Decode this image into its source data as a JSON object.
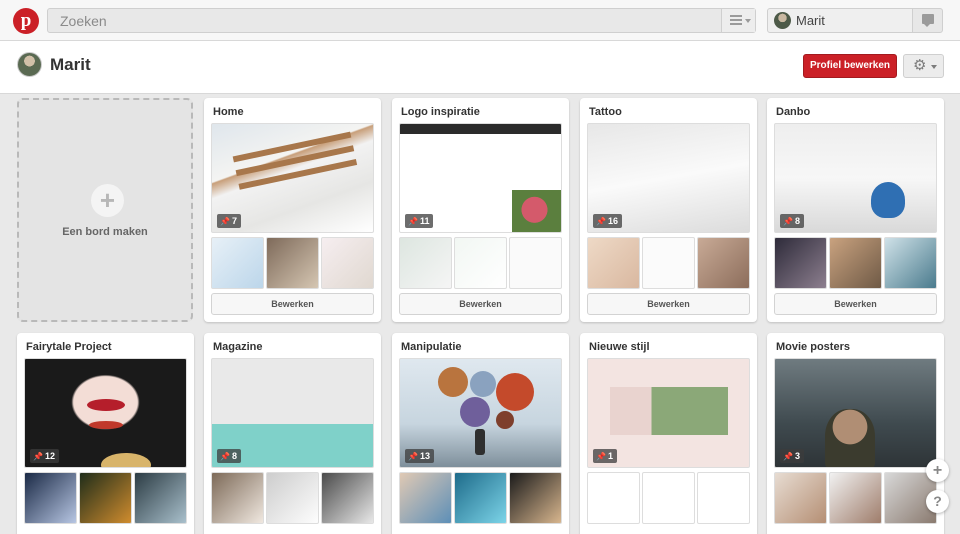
{
  "topbar": {
    "logo_letter": "p",
    "search_placeholder": "Zoeken",
    "user_name": "Marit"
  },
  "profile": {
    "name": "Marit",
    "edit_button": "Profiel bewerken"
  },
  "create_board": {
    "plus": "+",
    "label": "Een bord maken"
  },
  "boards": [
    {
      "title": "Home",
      "count": "7",
      "edit": "Bewerken"
    },
    {
      "title": "Logo inspiratie",
      "count": "11",
      "edit": "Bewerken"
    },
    {
      "title": "Tattoo",
      "count": "16",
      "edit": "Bewerken"
    },
    {
      "title": "Danbo",
      "count": "8",
      "edit": "Bewerken"
    },
    {
      "title": "Fairytale Project",
      "count": "12"
    },
    {
      "title": "Magazine",
      "count": "8"
    },
    {
      "title": "Manipulatie",
      "count": "13"
    },
    {
      "title": "Nieuwe stijl",
      "count": "1"
    },
    {
      "title": "Movie posters",
      "count": "3"
    }
  ],
  "fab": {
    "add": "+",
    "help": "?"
  },
  "colors": {
    "brand_red": "#cb2027"
  }
}
